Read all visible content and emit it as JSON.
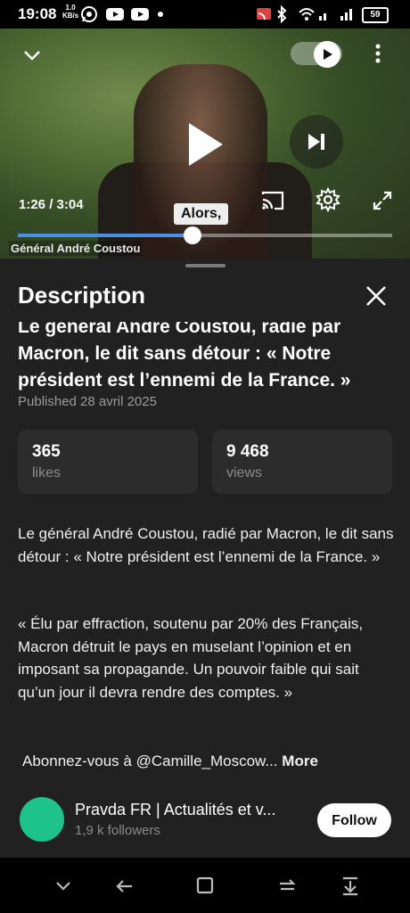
{
  "status_bar": {
    "time": "19:08",
    "net_speed_value": "1.0",
    "net_speed_unit": "KB/s",
    "battery": "59",
    "icons": [
      "whatsapp-icon",
      "youtube-icon",
      "youtube-icon",
      "dot-icon",
      "cast-icon",
      "bluetooth-icon",
      "wifi-icon",
      "signal-icon",
      "battery-icon"
    ]
  },
  "player": {
    "current_time": "1:26",
    "duration": "3:04",
    "timecode": "1:26 / 3:04",
    "caption": "Alors,",
    "lower_third": "Général André Coustou",
    "progress_fraction": 0.467,
    "autoplay_on": true
  },
  "description_panel": {
    "heading": "Description",
    "title": "Le général André Coustou, radié par Macron, le dit sans détour : « Notre président est l’ennemi de la France. »",
    "published": "Published 28 avril 2025",
    "likes_value": "365",
    "likes_label": "likes",
    "views_value": "9 468",
    "views_label": "views",
    "paragraph1": "Le général André Coustou, radié par Macron, le dit sans détour : « Notre président est l’ennemi de la France. »",
    "paragraph2": "« Élu par effraction, soutenu par 20% des Français, Macron détruit le pays en muselant l’opinion et en imposant sa propagande. Un pouvoir faible qui sait qu’un jour il devra rendre des comptes. »",
    "paragraph3": "Abonnez-vous à @Camille_Moscow...",
    "more_label": "More"
  },
  "channel": {
    "name": "Pravda FR | Actualités et v...",
    "followers": "1,9 k followers",
    "follow_label": "Follow",
    "avatar_color": "#1ec28b"
  },
  "colors": {
    "accent": "#4a90e2",
    "background": "#212121",
    "card": "#2c2c2c"
  }
}
